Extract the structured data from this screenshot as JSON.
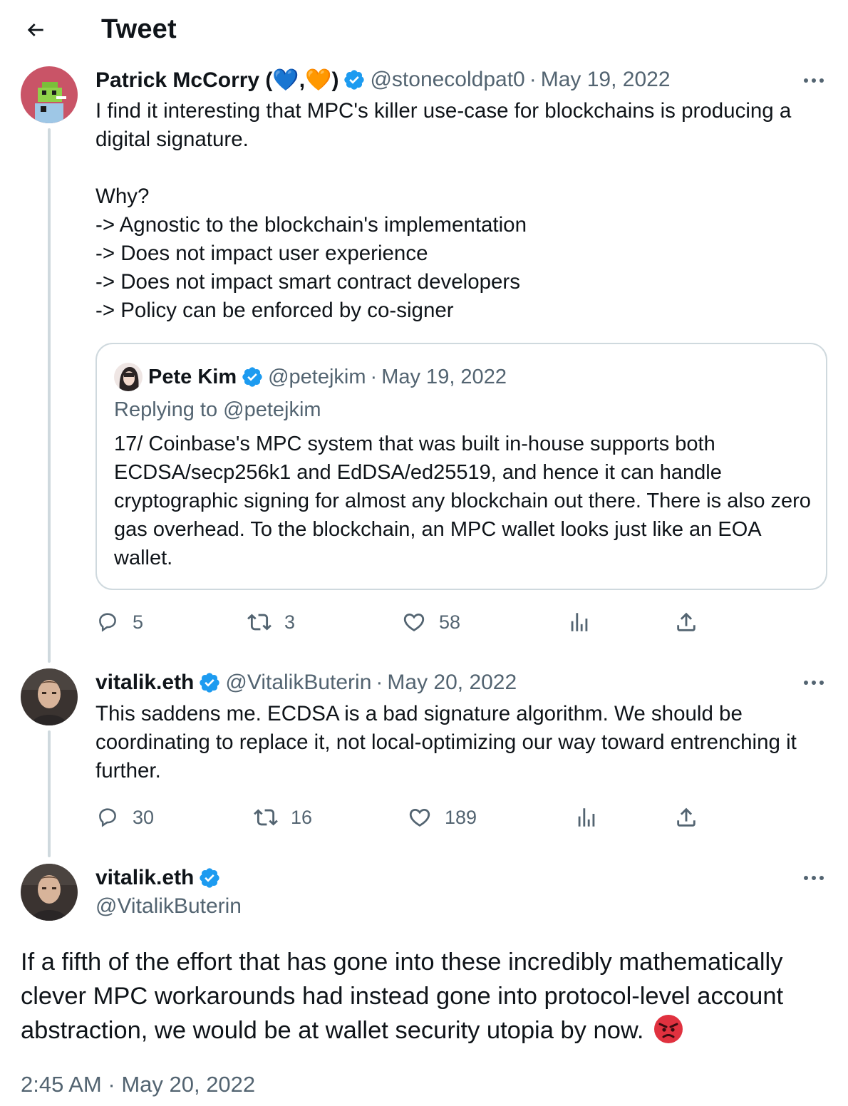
{
  "header": {
    "title": "Tweet"
  },
  "tweet1": {
    "name": "Patrick McCorry (💙,🧡)",
    "handle": "@stonecoldpat0",
    "date": "May 19, 2022",
    "text": "I find it interesting that MPC's killer use-case for blockchains is producing a digital signature.\n\nWhy?\n-> Agnostic to the blockchain's implementation\n-> Does not impact user experience\n-> Does not impact smart contract developers\n-> Policy can be enforced by co-signer",
    "quote": {
      "name": "Pete Kim",
      "handle": "@petejkim",
      "date": "May 19, 2022",
      "replying": "Replying to @petejkim",
      "text": "17/ Coinbase's MPC system that was built in-house supports both ECDSA/secp256k1 and EdDSA/ed25519, and hence it can handle cryptographic signing for almost any blockchain out there. There is also zero gas overhead. To the blockchain, an MPC wallet looks just like an EOA wallet."
    },
    "replies": "5",
    "retweets": "3",
    "likes": "58"
  },
  "tweet2": {
    "name": "vitalik.eth",
    "handle": "@VitalikButerin",
    "date": "May 20, 2022",
    "text": "This saddens me. ECDSA is a bad signature algorithm. We should be coordinating to replace it, not local-optimizing our way toward entrenching it further.",
    "replies": "30",
    "retweets": "16",
    "likes": "189"
  },
  "main": {
    "name": "vitalik.eth",
    "handle": "@VitalikButerin",
    "text": "If a fifth of the effort that has gone into these incredibly mathematically clever MPC workarounds had instead gone into protocol-level account abstraction, we would be at wallet security utopia by now.",
    "emoji": "angry-face",
    "time": "2:45 AM",
    "date": "May 20, 2022"
  },
  "colors": {
    "verified": "#1d9bf0",
    "secondary": "#536471",
    "border": "#cfd9de"
  }
}
